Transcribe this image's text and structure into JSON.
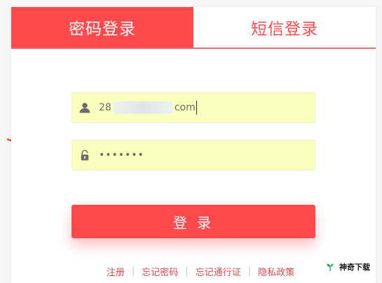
{
  "tabs": {
    "password_login": "密码登录",
    "sms_login": "短信登录"
  },
  "fields": {
    "username": {
      "visible_prefix": "28",
      "visible_suffix": "com"
    },
    "password": {
      "masked_value": "•••••••"
    }
  },
  "actions": {
    "login_button": "登 录"
  },
  "footer_links": [
    "注册",
    "忘记密码",
    "忘记通行证",
    "隐私政策"
  ],
  "footer_separator": "|",
  "watermark": {
    "text": "神奇下载"
  },
  "colors": {
    "accent_red": "#ff4a4d",
    "input_bg": "#faffbd",
    "page_bg": "#f6f6f6"
  },
  "icons": {
    "username": "user-icon",
    "password": "lock-icon",
    "watermark": "sprout-icon"
  }
}
